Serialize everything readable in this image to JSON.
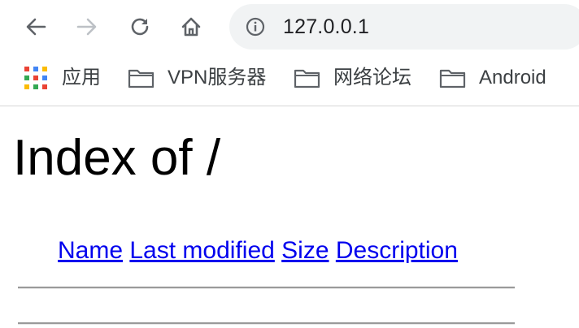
{
  "browser": {
    "url": "127.0.0.1",
    "icons": {
      "back": "arrow-left-icon",
      "forward": "arrow-right-icon",
      "reload": "reload-icon",
      "home": "home-icon",
      "site_info": "info-circle-icon"
    }
  },
  "bookmarks": [
    {
      "label": "应用",
      "icon": "apps-grid-icon"
    },
    {
      "label": "VPN服务器",
      "icon": "folder-icon"
    },
    {
      "label": "网络论坛",
      "icon": "folder-icon"
    },
    {
      "label": "Android",
      "icon": "folder-icon"
    }
  ],
  "page": {
    "title": "Index of /",
    "columns": [
      {
        "label": "Name"
      },
      {
        "label": "Last modified"
      },
      {
        "label": "Size"
      },
      {
        "label": "Description"
      }
    ]
  },
  "colors": {
    "link": "#0000ee",
    "omnibox_bg": "#f1f3f4",
    "text": "#000000"
  }
}
